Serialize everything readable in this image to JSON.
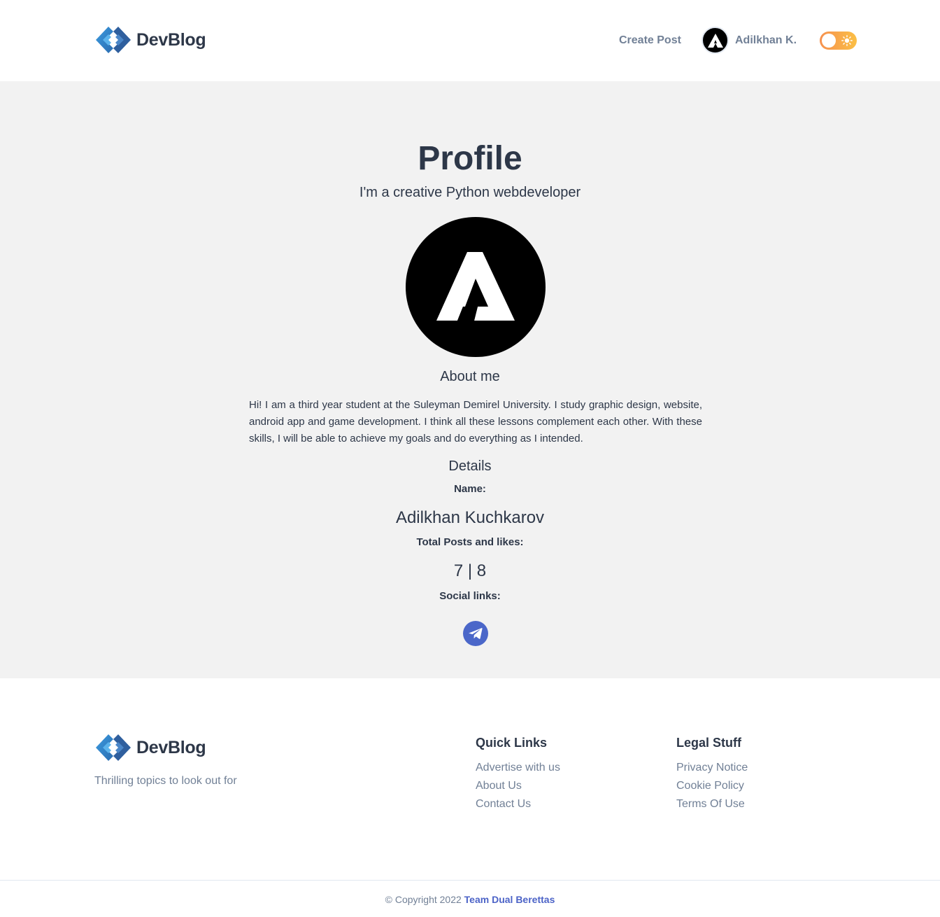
{
  "header": {
    "brand_name": "DevBlog",
    "create_post_label": "Create Post",
    "username": "Adilkhan K."
  },
  "profile": {
    "title": "Profile",
    "tagline": "I'm a creative Python webdeveloper",
    "about_heading": "About me",
    "about_text": "Hi! I am a third year student at the Suleyman Demirel University. I study graphic design, website, android app and game development. I think all these lessons complement each other. With these skills, I will be able to achieve my goals and do everything as I intended.",
    "details_heading": "Details",
    "name_label": "Name:",
    "name_value": "Adilkhan Kuchkarov",
    "posts_label": "Total Posts and likes:",
    "posts_value": "7 | 8",
    "social_label": "Social links:"
  },
  "footer": {
    "brand_name": "DevBlog",
    "tagline": "Thrilling topics to look out for",
    "quick_links": {
      "title": "Quick Links",
      "items": [
        "Advertise with us",
        "About Us",
        "Contact Us"
      ]
    },
    "legal": {
      "title": "Legal Stuff",
      "items": [
        "Privacy Notice",
        "Cookie Policy",
        "Terms Of Use"
      ]
    },
    "copyright": "© Copyright 2022",
    "team": "Team Dual Berettas"
  },
  "colors": {
    "accent": "#4c63c7",
    "toggle_start": "#f6914f",
    "toggle_end": "#fbbf45",
    "telegram": "#4b67c9"
  },
  "icons": [
    "devblog-logo-icon",
    "avatar-logo-icon",
    "sun-icon",
    "telegram-icon"
  ]
}
